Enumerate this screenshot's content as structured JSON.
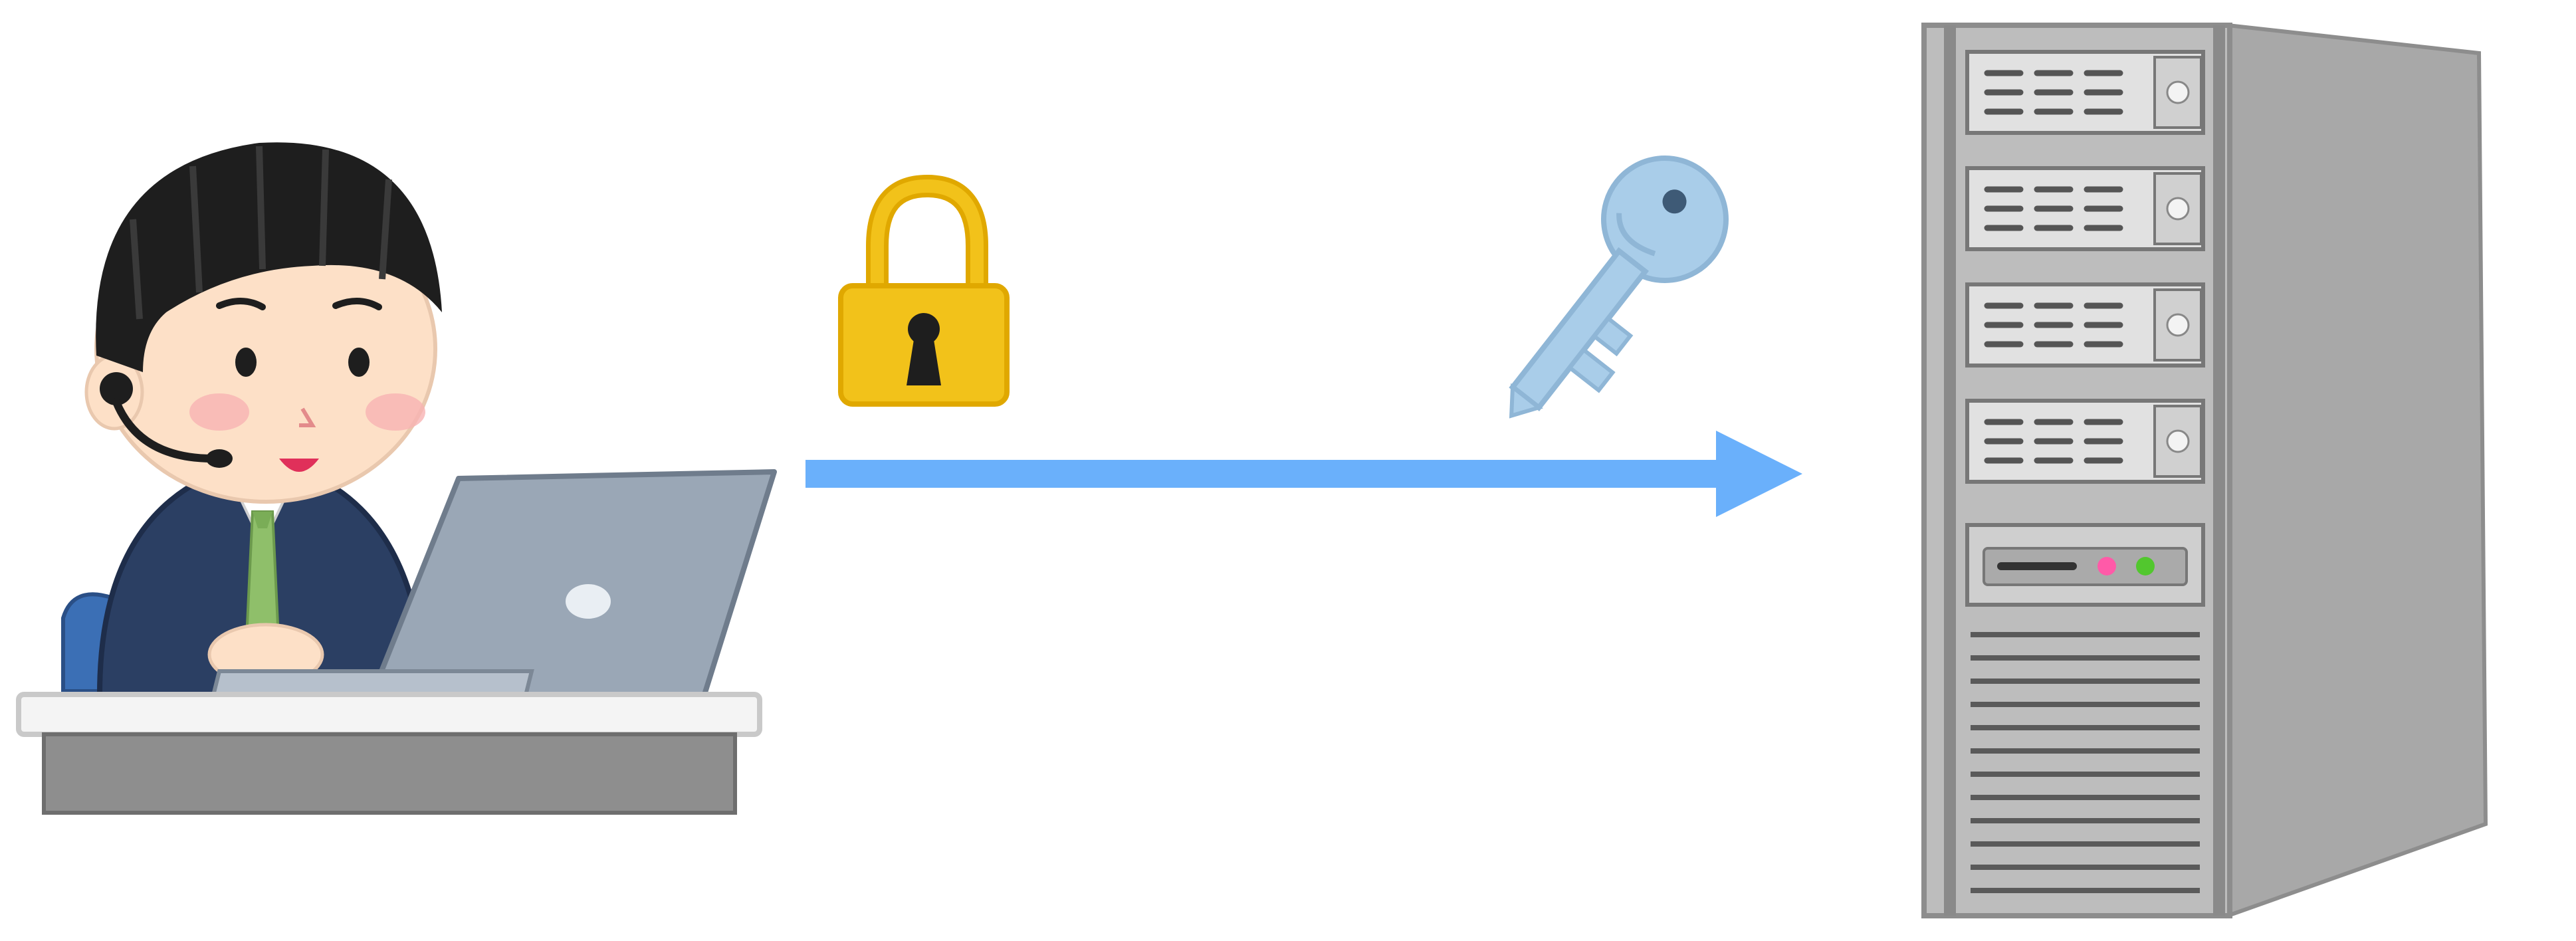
{
  "diagram": {
    "nodes": [
      {
        "id": "client",
        "icon": "operator-with-laptop-icon"
      },
      {
        "id": "lock",
        "icon": "padlock-icon"
      },
      {
        "id": "key",
        "icon": "key-icon"
      },
      {
        "id": "server",
        "icon": "server-tower-icon"
      }
    ],
    "edges": [
      {
        "from": "client",
        "to": "server",
        "style": "arrow"
      }
    ]
  },
  "colors": {
    "arrow": "#6ab0fb",
    "lock_body": "#f2c21a",
    "lock_outline": "#e0a800",
    "key": "#a9cde9",
    "key_outline": "#8fb6d6",
    "server_front": "#bdbdbd",
    "server_side": "#a8a8a8",
    "suit": "#2b3f63",
    "tie": "#8fbf6a",
    "laptop": "#9aa7b6",
    "desk_top": "#f4f4f4",
    "desk_side": "#8e8e8e",
    "hair": "#1e1e1e",
    "skin": "#fde0c7",
    "led_pink": "#ff5aa8",
    "led_green": "#52c72e"
  }
}
